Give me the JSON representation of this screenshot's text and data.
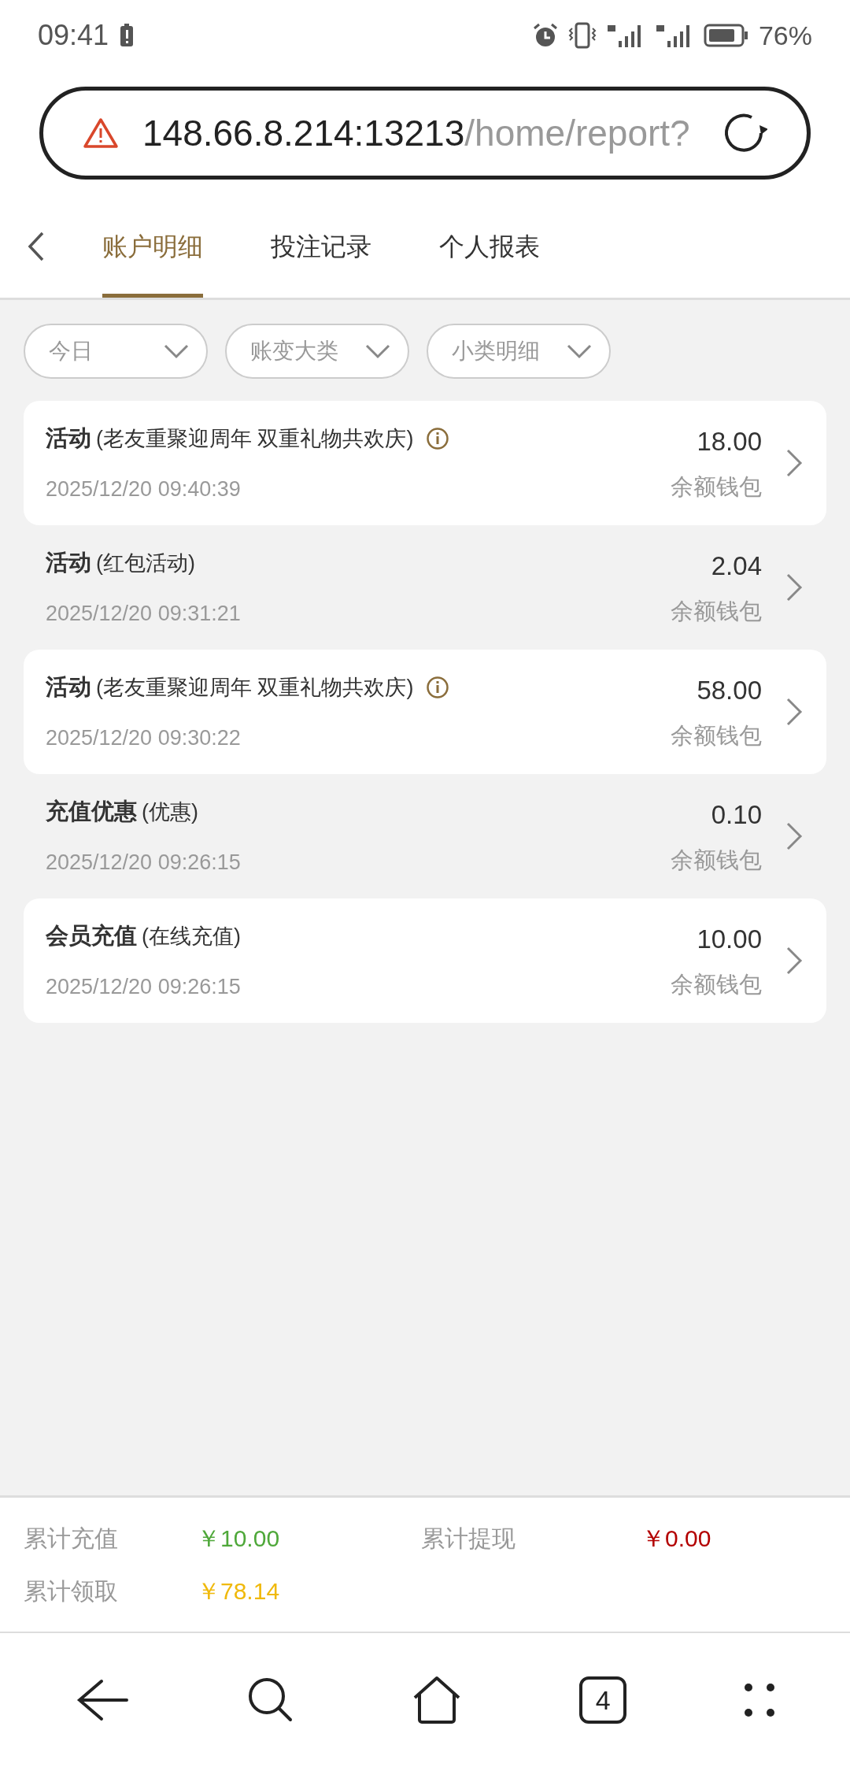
{
  "status_bar": {
    "time": "09:41",
    "battery": "76%"
  },
  "address_bar": {
    "host": "148.66.8.214:13213",
    "path": "/home/report?"
  },
  "tabs": [
    {
      "label": "账户明细",
      "selected": true
    },
    {
      "label": "投注记录",
      "selected": false
    },
    {
      "label": "个人报表",
      "selected": false
    }
  ],
  "filters": [
    {
      "placeholder": "今日"
    },
    {
      "placeholder": "账变大类"
    },
    {
      "placeholder": "小类明细"
    }
  ],
  "records": [
    {
      "title": "活动",
      "detail": "(老友重聚迎周年 双重礼物共欢庆)",
      "info": true,
      "time": "2025/12/20 09:40:39",
      "amount": "18.00",
      "wallet": "余额钱包",
      "kind": "card"
    },
    {
      "title": "活动",
      "detail": "(红包活动)",
      "info": false,
      "time": "2025/12/20 09:31:21",
      "amount": "2.04",
      "wallet": "余额钱包",
      "kind": "plain"
    },
    {
      "title": "活动",
      "detail": "(老友重聚迎周年 双重礼物共欢庆)",
      "info": true,
      "time": "2025/12/20 09:30:22",
      "amount": "58.00",
      "wallet": "余额钱包",
      "kind": "card"
    },
    {
      "title": "充值优惠",
      "detail": "(优惠)",
      "info": false,
      "time": "2025/12/20 09:26:15",
      "amount": "0.10",
      "wallet": "余额钱包",
      "kind": "plain"
    },
    {
      "title": "会员充值",
      "detail": "(在线充值)",
      "info": false,
      "time": "2025/12/20 09:26:15",
      "amount": "10.00",
      "wallet": "余额钱包",
      "kind": "card"
    }
  ],
  "summary": [
    {
      "label": "累计充值",
      "value": "￥10.00",
      "color": "#4fa83a"
    },
    {
      "label": "累计提现",
      "value": "￥0.00",
      "color": "#b30000"
    },
    {
      "label": "累计领取",
      "value": "￥78.14",
      "color": "#f0b90b"
    }
  ],
  "nav_bar": {
    "tab_count": "4"
  }
}
